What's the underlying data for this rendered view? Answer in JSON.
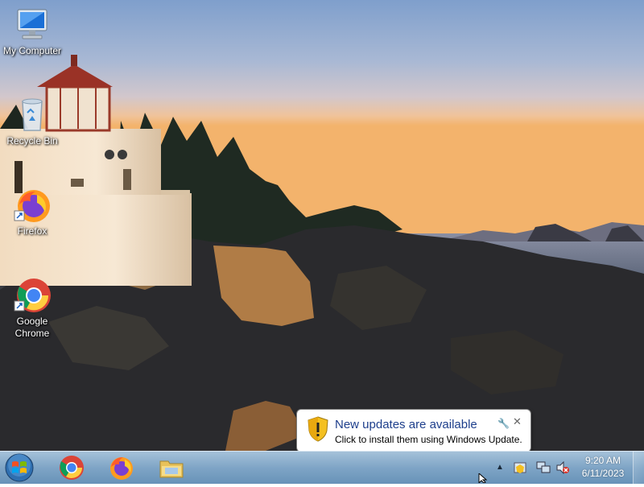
{
  "desktop_icons": [
    {
      "label": "My Computer",
      "icon": "computer-icon"
    },
    {
      "label": "Recycle Bin",
      "icon": "recycle-bin-icon"
    },
    {
      "label": "Firefox",
      "icon": "firefox-icon"
    },
    {
      "label": "Google Chrome",
      "icon": "chrome-icon"
    }
  ],
  "taskbar": {
    "pinned": [
      {
        "name": "Google Chrome",
        "icon": "chrome-icon"
      },
      {
        "name": "Firefox",
        "icon": "firefox-icon"
      },
      {
        "name": "Windows Explorer",
        "icon": "folder-icon"
      }
    ]
  },
  "notification": {
    "title": "New updates are available",
    "body": "Click to install them using Windows Update."
  },
  "clock": {
    "time": "9:20 AM",
    "date": "6/11/2023"
  },
  "colors": {
    "balloon_title": "#1e3f8c",
    "taskbar": "#7aa3c6"
  }
}
